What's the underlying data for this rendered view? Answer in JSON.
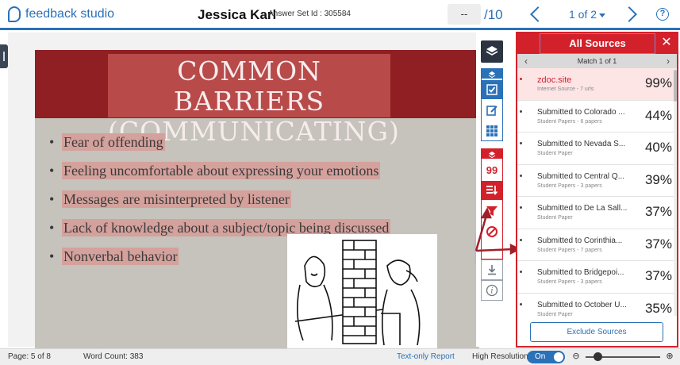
{
  "header": {
    "logo_text": "feedback studio",
    "student_name": "Jessica Karl",
    "answer_set": "Answer Set Id : 305584",
    "grade_value": "--",
    "grade_total": "/10",
    "page_indicator": "1 of 2",
    "help": "?"
  },
  "slide": {
    "title": "COMMON BARRIERS (COMMUNICATING)",
    "bullet_mark": "•",
    "bullets": [
      "Fear of offending",
      "Feeling uncomfortable about expressing your emotions",
      "Messages are misinterpreted by listener",
      "Lack of knowledge about a subject/topic being discussed",
      "Nonverbal behavior"
    ]
  },
  "toolbar": {
    "similarity_score": "99",
    "info_symbol": "i"
  },
  "sources": {
    "title": "All Sources",
    "close": "✕",
    "match_label": "Match 1 of 1",
    "prev": "‹",
    "next": "›",
    "items": [
      {
        "name": "zdoc.site",
        "sub": "Internet Source - 7 urls",
        "pct": "99%"
      },
      {
        "name": "Submitted to Colorado ...",
        "sub": "Student Papers - 6 papers",
        "pct": "44%"
      },
      {
        "name": "Submitted to Nevada S...",
        "sub": "Student Paper",
        "pct": "40%"
      },
      {
        "name": "Submitted to Central Q...",
        "sub": "Student Papers - 3 papers",
        "pct": "39%"
      },
      {
        "name": "Submitted to De La Sall...",
        "sub": "Student Paper",
        "pct": "37%"
      },
      {
        "name": "Submitted to Corinthia...",
        "sub": "Student Papers - 7 papers",
        "pct": "37%"
      },
      {
        "name": "Submitted to Bridgepoi...",
        "sub": "Student Papers - 3 papers",
        "pct": "37%"
      },
      {
        "name": "Submitted to October U...",
        "sub": "Student Paper",
        "pct": "35%"
      }
    ],
    "exclude_label": "Exclude Sources"
  },
  "status": {
    "page": "Page: 5 of 8",
    "word_count": "Word Count: 383",
    "text_only": "Text-only Report",
    "high_res": "High Resolution",
    "toggle_state": "On",
    "zoom_out": "⊖",
    "zoom_in": "⊕"
  },
  "colors": {
    "brand_blue": "#2b71b8",
    "alert_red": "#d3212c",
    "slide_header": "#8f1f22"
  }
}
